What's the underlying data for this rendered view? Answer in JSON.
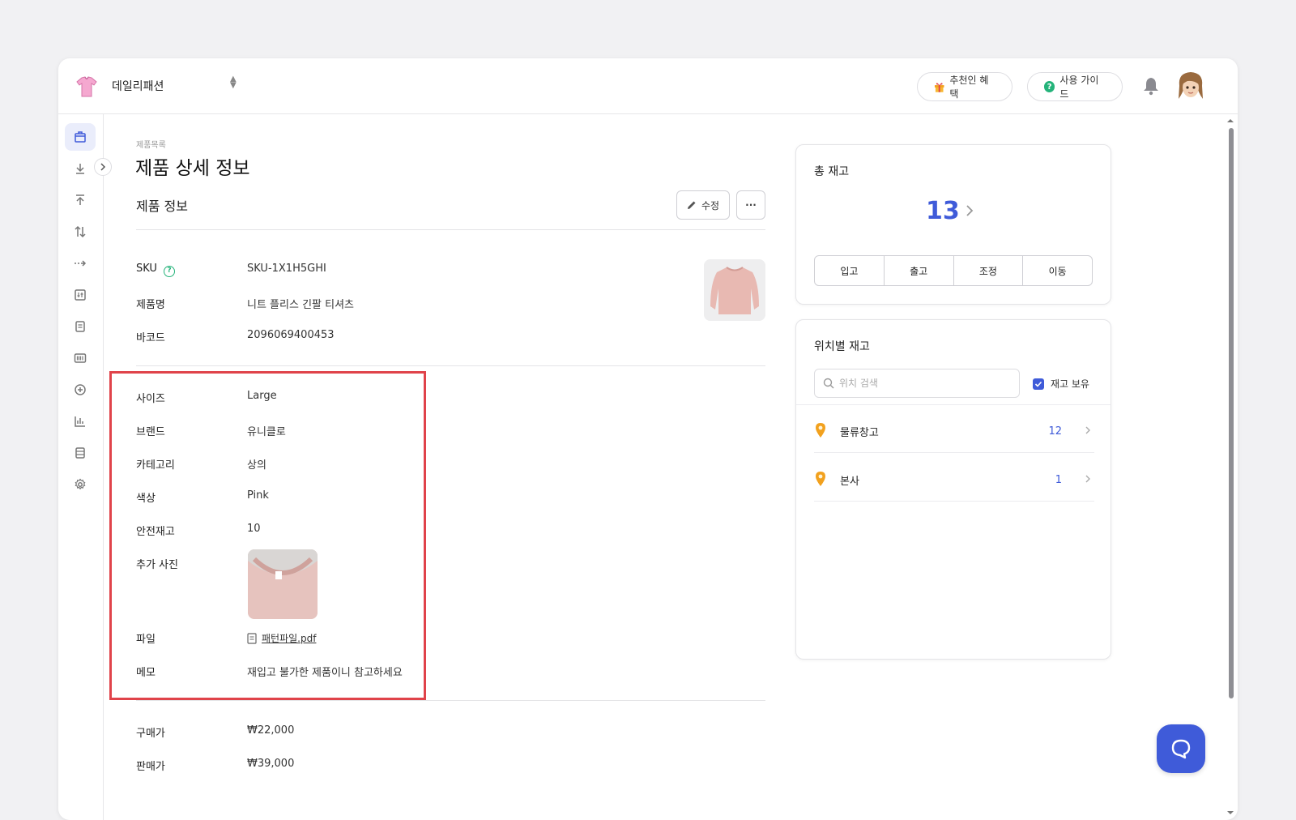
{
  "header": {
    "shop_name": "데일리패션",
    "referral_label": "추천인 혜택",
    "guide_label": "사용 가이드"
  },
  "breadcrumb": "제품목록",
  "page_title": "제품 상세 정보",
  "section_title": "제품 정보",
  "actions": {
    "edit_label": "수정",
    "more_label": "···"
  },
  "basic": [
    {
      "label": "SKU",
      "value": "SKU-1X1H5GHI"
    },
    {
      "label": "제품명",
      "value": "니트 플리스 긴팔 티셔츠"
    },
    {
      "label": "바코드",
      "value": "2096069400453"
    }
  ],
  "attributes": [
    {
      "label": "사이즈",
      "value": "Large"
    },
    {
      "label": "브랜드",
      "value": "유니클로"
    },
    {
      "label": "카테고리",
      "value": "상의"
    },
    {
      "label": "색상",
      "value": "Pink"
    },
    {
      "label": "안전재고",
      "value": "10"
    },
    {
      "label": "추가 사진",
      "value": ""
    },
    {
      "label": "파일",
      "value": "패턴파일.pdf"
    },
    {
      "label": "메모",
      "value": "재입고 불가한 제품이니 참고하세요"
    }
  ],
  "pricing": [
    {
      "label": "구매가",
      "value": "₩22,000"
    },
    {
      "label": "판매가",
      "value": "₩39,000"
    }
  ],
  "total_stock": {
    "title": "총 재고",
    "value": "13",
    "buttons": [
      "입고",
      "출고",
      "조정",
      "이동"
    ]
  },
  "location_stock": {
    "title": "위치별 재고",
    "search_placeholder": "위치 검색",
    "filter_label": "재고 보유",
    "filter_checked": true,
    "rows": [
      {
        "name": "물류창고",
        "count": "12"
      },
      {
        "name": "본사",
        "count": "1"
      }
    ]
  },
  "colors": {
    "accent": "#3f5bd9",
    "highlight": "#e0434a",
    "pin": "#f2a11e",
    "help": "#24b37a"
  },
  "icons": {
    "sidebar": [
      "box-icon",
      "download-icon",
      "upload-icon",
      "swap-icon",
      "move-icon",
      "adjust-icon",
      "document-icon",
      "barcode-icon",
      "add-circle-icon",
      "bar-chart-icon",
      "table-icon",
      "settings-icon"
    ]
  }
}
